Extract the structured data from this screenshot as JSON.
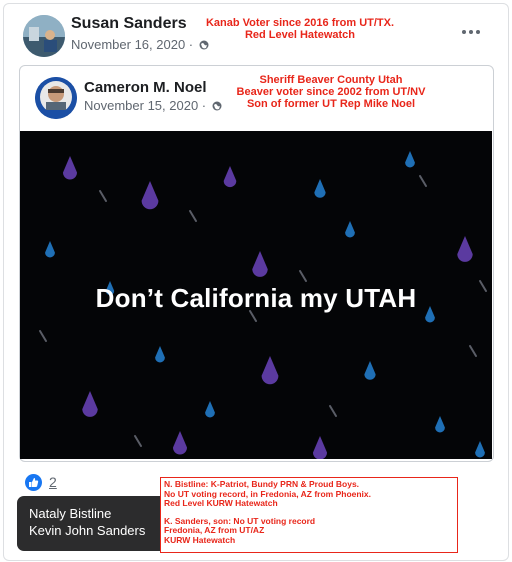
{
  "post": {
    "poster_name": "Susan Sanders",
    "poster_date": "November 16, 2020 ·",
    "poster_note": [
      "Kanab Voter since 2016 from UT/TX.",
      "Red Level Hatewatch"
    ],
    "more_icon": "more-options-icon"
  },
  "shared": {
    "name": "Cameron M. Noel",
    "date": "November 15, 2020 ·",
    "note": [
      "Sheriff Beaver County Utah",
      "Beaver voter since 2002 from UT/NV",
      "Son of former UT Rep Mike Noel"
    ],
    "image_text": "Don’t California my UTAH"
  },
  "reactions": {
    "count": "2",
    "icon": "like-icon"
  },
  "tooltip": {
    "names": [
      "Nataly Bistline",
      "Kevin John Sanders"
    ]
  },
  "info_box": {
    "lines_a": [
      "N. Bistline: K-Patriot, Bundy PRN & Proud Boys.",
      "No UT voting record, in Fredonia, AZ from Phoenix.",
      "Red Level KURW Hatewatch"
    ],
    "lines_b": [
      "K. Sanders, son: No UT voting record",
      "Fredonia, AZ from UT/AZ",
      "KURW Hatewatch"
    ]
  },
  "colors": {
    "annotation_red": "#e8261a",
    "like_blue": "#1877f2",
    "image_bg": "#040507"
  }
}
